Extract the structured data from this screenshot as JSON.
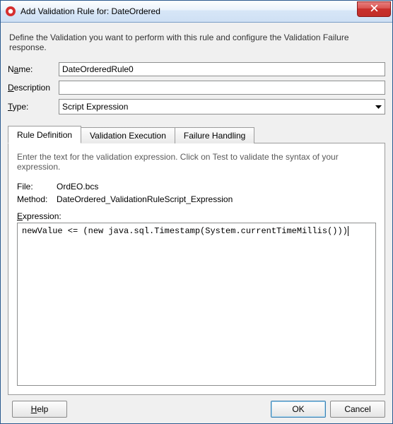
{
  "window": {
    "title": "Add Validation Rule for: DateOrdered"
  },
  "intro": "Define the Validation you want to perform with this rule and configure the Validation Failure response.",
  "form": {
    "name_label_pre": "N",
    "name_label_ul": "a",
    "name_label_post": "me:",
    "name_value": "DateOrderedRule0",
    "desc_label_pre": "",
    "desc_label_ul": "D",
    "desc_label_post": "escription",
    "desc_value": "",
    "type_label_pre": "",
    "type_label_ul": "T",
    "type_label_post": "ype:",
    "type_value": "Script Expression"
  },
  "tabs": {
    "t0": "Rule Definition",
    "t1": "Validation Execution",
    "t2": "Failure Handling"
  },
  "panel": {
    "intro": "Enter the text for the validation expression. Click on Test to validate the syntax of your expression.",
    "file_label": "File:",
    "file_value": "OrdEO.bcs",
    "method_label": "Method:",
    "method_value": "DateOrdered_ValidationRuleScript_Expression",
    "expr_label_ul": "E",
    "expr_label_post": "xpression:",
    "expression": "newValue <= (new java.sql.Timestamp(System.currentTimeMillis()))"
  },
  "buttons": {
    "help_ul": "H",
    "help_post": "elp",
    "ok": "OK",
    "cancel": "Cancel"
  }
}
